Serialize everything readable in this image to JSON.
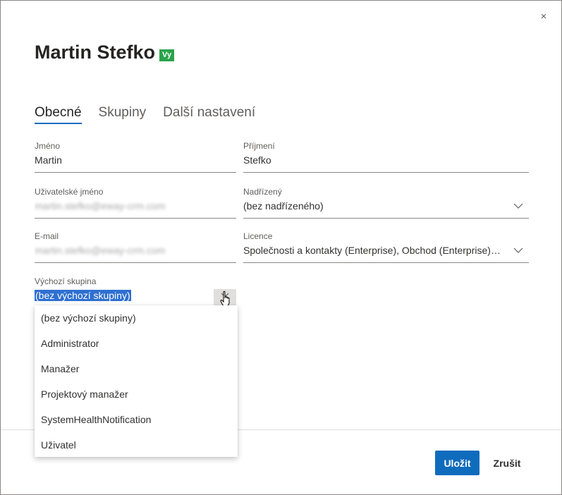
{
  "dialog": {
    "title": "Martin Stefko",
    "badge": "Vy",
    "close_symbol": "×"
  },
  "tabs": [
    {
      "label": "Obecné",
      "active": true
    },
    {
      "label": "Skupiny",
      "active": false
    },
    {
      "label": "Další nastavení",
      "active": false
    }
  ],
  "fields": {
    "first_name": {
      "label": "Jméno",
      "value": "Martin"
    },
    "last_name": {
      "label": "Příjmení",
      "value": "Stefko"
    },
    "username": {
      "label": "Uživatelské jméno",
      "value": "martin.stefko@eway-crm.com"
    },
    "supervisor": {
      "label": "Nadřízený",
      "value": "(bez nadřízeného)"
    },
    "email": {
      "label": "E-mail",
      "value": "martin.stefko@eway-crm.com"
    },
    "license": {
      "label": "Licence",
      "value": "Společnosti a kontakty (Enterprise), Obchod (Enterprise), P..."
    },
    "default_group": {
      "label": "Výchozí skupina",
      "value": "(bez výchozí skupiny)"
    }
  },
  "dropdown_options": [
    "(bez výchozí skupiny)",
    "Administrator",
    "Manažer",
    "Projektový manažer",
    "SystemHealthNotification",
    "Uživatel"
  ],
  "footer": {
    "save_label": "Uložit",
    "cancel_label": "Zrušit"
  },
  "colors": {
    "accent": "#0f6cbd",
    "badge": "#2aa34a",
    "selection": "#2e6fd1"
  }
}
